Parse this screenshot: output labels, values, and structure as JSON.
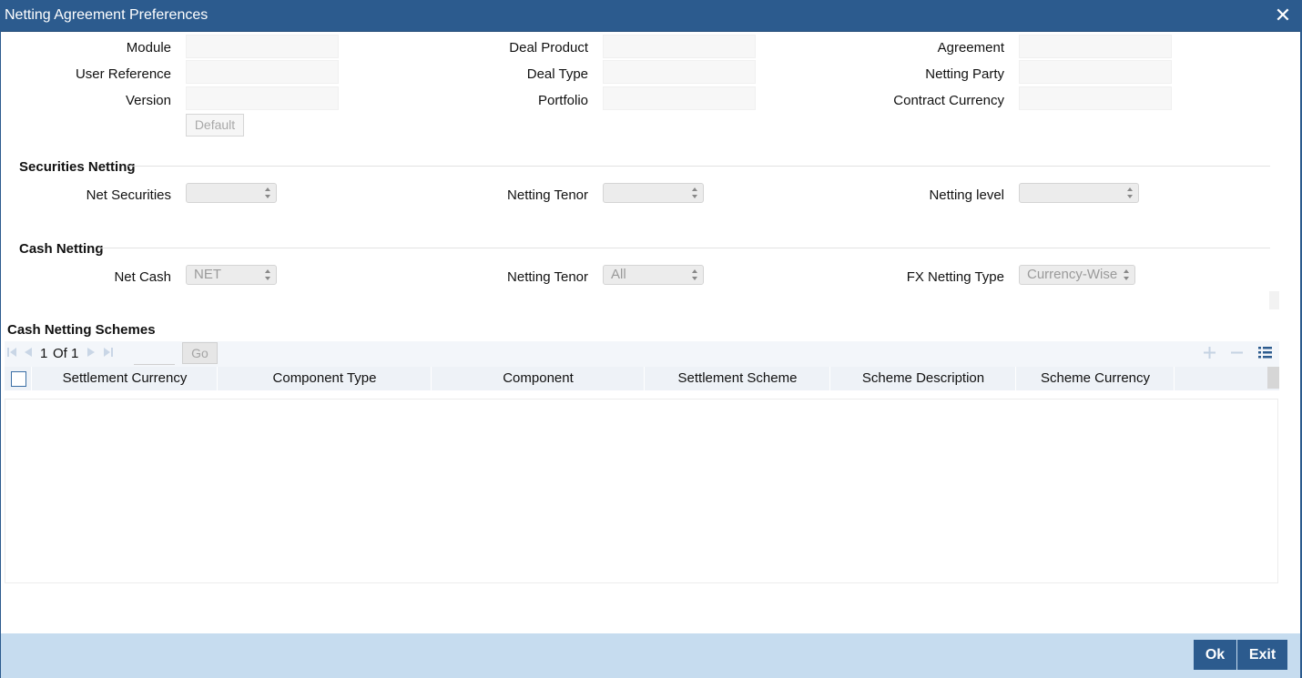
{
  "window": {
    "title": "Netting Agreement Preferences"
  },
  "fields": {
    "module": "Module",
    "user_reference": "User Reference",
    "version": "Version",
    "deal_product": "Deal Product",
    "deal_type": "Deal Type",
    "portfolio": "Portfolio",
    "agreement": "Agreement",
    "netting_party": "Netting Party",
    "contract_currency": "Contract Currency",
    "default_button": "Default"
  },
  "securities_netting": {
    "heading": "Securities Netting",
    "net_securities_label": "Net Securities",
    "net_securities_value": "",
    "netting_tenor_label": "Netting Tenor",
    "netting_tenor_value": "",
    "netting_level_label": "Netting level",
    "netting_level_value": ""
  },
  "cash_netting": {
    "heading": "Cash Netting",
    "net_cash_label": "Net Cash",
    "net_cash_value": "NET",
    "netting_tenor_label": "Netting Tenor",
    "netting_tenor_value": "All",
    "fx_netting_type_label": "FX Netting Type",
    "fx_netting_type_value": "Currency-Wise"
  },
  "schemes": {
    "heading": "Cash Netting Schemes",
    "pagination": {
      "current": "1",
      "of_label": "Of",
      "total": "1",
      "go_label": "Go"
    },
    "columns": [
      "Settlement Currency",
      "Component Type",
      "Component",
      "Settlement Scheme",
      "Scheme Description",
      "Scheme Currency"
    ],
    "toolbar_icons": [
      "add-row-icon",
      "delete-row-icon",
      "list-view-icon"
    ]
  },
  "footer": {
    "ok_label": "Ok",
    "exit_label": "Exit"
  },
  "colors": {
    "title_bar": "#2c5b8e",
    "footer": "#c6dcef",
    "button": "#2c5b8e"
  }
}
